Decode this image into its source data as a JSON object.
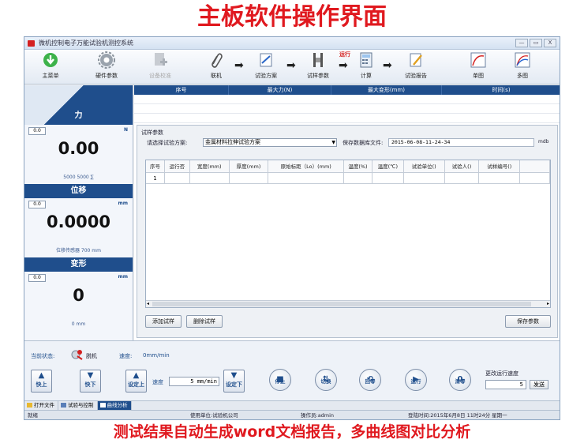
{
  "banner": {
    "top": "主板软件操作界面",
    "bottom": "测试结果自动生成word文档报告，多曲线图对比分析"
  },
  "window": {
    "title": "微机控制电子万能试验机测控系统",
    "buttons": [
      "—",
      "▭",
      "X"
    ]
  },
  "toolbar": {
    "main_menu": "主菜单",
    "hardware_params": "硬件参数",
    "device_adjust": "设备校准",
    "connect": "联机",
    "test_plan": "试验方案",
    "specimen_params": "试样参数",
    "run_label": "运行",
    "calculate": "计算",
    "test_report": "试验报告",
    "single_chart": "单图",
    "multi_chart": "多图"
  },
  "left_panel": {
    "force": {
      "label": "力",
      "zero": "0.0",
      "unit": "N",
      "value": "0.00",
      "sub": "5000 5000 ∑"
    },
    "displacement": {
      "label": "位移",
      "zero": "0.0",
      "unit": "mm",
      "value": "0.0000",
      "sub": "位移传感器 700 mm"
    },
    "deformation": {
      "label": "变形",
      "zero": "0.0",
      "unit": "mm",
      "value": "0",
      "sub": "0 mm"
    }
  },
  "results": {
    "columns": [
      "序号",
      "最大力(N)",
      "最大变形(mm)",
      "时间(s)"
    ]
  },
  "specimen": {
    "title": "试样参数",
    "choose_label": "请选择试验方案:",
    "plan_value": "金属材料拉伸试验方案",
    "save_label": "保存数据库文件:",
    "save_value": "2015-06-08-11-24-34",
    "save_ext": "mdb",
    "columns": [
      "序号",
      "运行否",
      "宽度(mm)",
      "厚度(mm)",
      "原始标距（Lo）(mm)",
      "温度(%)",
      "温度(℃)",
      "试验单位()",
      "试验人()",
      "试样编号()"
    ],
    "rows": [
      [
        "1",
        "",
        "",
        "",
        "",
        "",
        "",
        "",
        "",
        ""
      ]
    ],
    "add_button": "添加试样",
    "delete_button": "删除试样",
    "save_params_button": "保存参数"
  },
  "status": {
    "state_label": "当前状态:",
    "state_value": "脱机",
    "speed_label": "速度:",
    "speed_value": "0mm/min"
  },
  "controls": {
    "fast_up": "快上",
    "fast_down": "快下",
    "set_up": "设定上",
    "speed_label": "速度",
    "speed_value": "5",
    "speed_unit": "mm/min",
    "set_down": "设定下",
    "stop": "停止",
    "switch": "切换",
    "return": "回零",
    "run": "运行",
    "clear": "清零",
    "change_speed_label": "更改运行速度",
    "change_speed_value": "5",
    "send": "发送"
  },
  "tabs": [
    "打开文件",
    "试验与控制",
    "曲线分析"
  ],
  "statusbar": {
    "ready": "就绪",
    "company": "使用单位:试验机公司",
    "operator": "操作员:admin",
    "login_time": "登陆时间:2015年6月8日 11时24分 星期一"
  },
  "colors": {
    "accent": "#1f4e8c",
    "banner_red": "#e0191f"
  }
}
